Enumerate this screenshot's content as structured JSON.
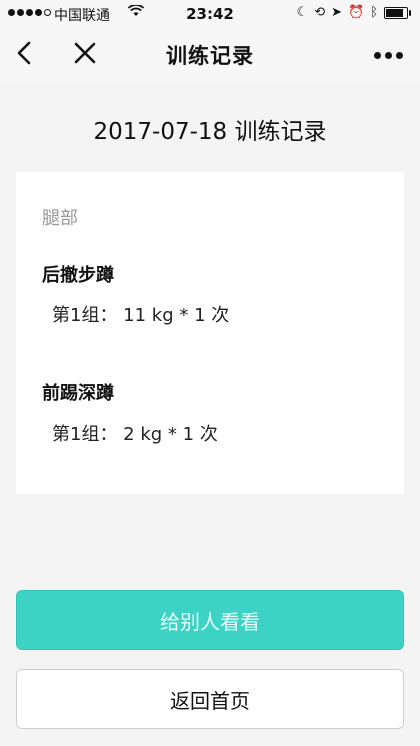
{
  "status_bar": {
    "carrier": "中国联通",
    "time": "23:42",
    "wifi_icon": "wifi-icon",
    "battery_level": 0.9
  },
  "nav": {
    "title": "训练记录",
    "back_icon": "chevron-left-icon",
    "close_icon": "close-icon",
    "more_icon": "more-dots-icon"
  },
  "page_title": "2017-07-18 训练记录",
  "record": {
    "category": "腿部",
    "exercises": [
      {
        "name": "后撤步蹲",
        "sets": [
          "第1组：  11 kg * 1 次"
        ]
      },
      {
        "name": "前踢深蹲",
        "sets": [
          "第1组：  2 kg * 1 次"
        ]
      }
    ]
  },
  "buttons": {
    "share_label": "给别人看看",
    "home_label": "返回首页"
  },
  "colors": {
    "accent": "#3dd3c4",
    "background": "#f4f4f4"
  }
}
